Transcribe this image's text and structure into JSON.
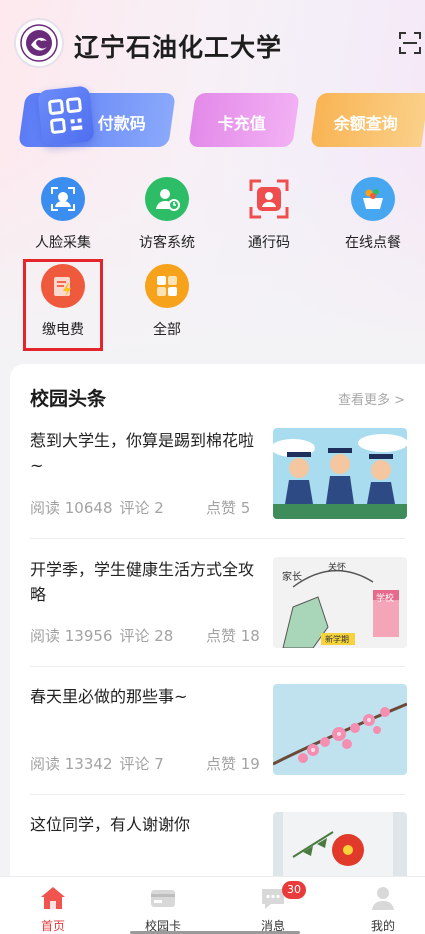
{
  "header": {
    "title": "辽宁石油化工大学",
    "logo_icon": "university-logo-icon",
    "scan_icon": "scan-icon"
  },
  "actions": [
    {
      "label": "付款码",
      "color": "#5b7cf6"
    },
    {
      "label": "卡充值",
      "color": "#e38ae9"
    },
    {
      "label": "余额查询",
      "color": "#f9b454"
    }
  ],
  "services": [
    {
      "label": "人脸采集",
      "icon": "face-capture-icon",
      "color": "#3b8ef0"
    },
    {
      "label": "访客系统",
      "icon": "visitor-icon",
      "color": "#2dbd66"
    },
    {
      "label": "通行码",
      "icon": "pass-code-icon",
      "color": "#f04e4e"
    },
    {
      "label": "在线点餐",
      "icon": "order-food-icon",
      "color": "#46a6f0"
    },
    {
      "label": "缴电费",
      "icon": "electricity-bill-icon",
      "color": "#f05a3c"
    },
    {
      "label": "全部",
      "icon": "all-apps-icon",
      "color": "#f7a21b"
    }
  ],
  "news": {
    "heading": "校园头条",
    "more": "查看更多 >",
    "items": [
      {
        "title": "惹到大学生，你算是踢到棉花啦~",
        "reads": "阅读 10648",
        "comments": "评论 2",
        "likes": "点赞 5"
      },
      {
        "title": "开学季，学生健康生活方式全攻略",
        "reads": "阅读 13956",
        "comments": "评论 28",
        "likes": "点赞 18"
      },
      {
        "title": "春天里必做的那些事~",
        "reads": "阅读 13342",
        "comments": "评论 7",
        "likes": "点赞 19"
      },
      {
        "title": "这位同学，有人谢谢你",
        "reads": "",
        "comments": "",
        "likes": ""
      }
    ],
    "thumb2_labels": {
      "parent": "家长",
      "care": "关怀",
      "school": "学校",
      "term": "新学期"
    }
  },
  "nav": {
    "items": [
      {
        "label": "首页",
        "icon": "home-icon"
      },
      {
        "label": "校园卡",
        "icon": "campus-card-icon"
      },
      {
        "label": "消息",
        "icon": "message-icon"
      },
      {
        "label": "我的",
        "icon": "profile-icon"
      }
    ],
    "badge": "30",
    "active_color": "#e83b3b"
  }
}
